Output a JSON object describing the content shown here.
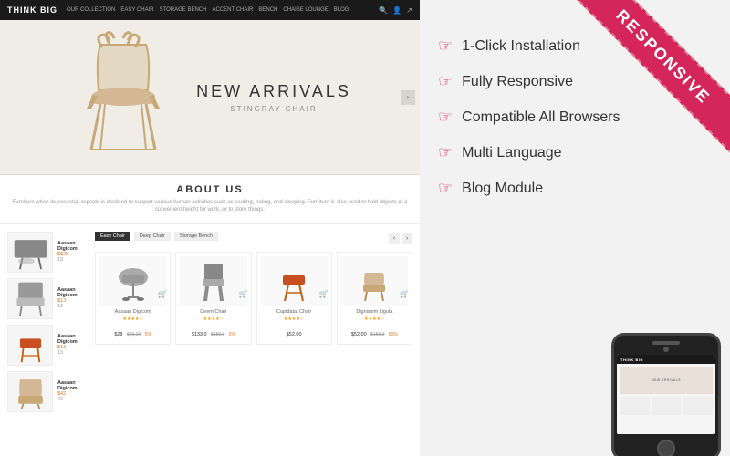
{
  "site": {
    "logo": "THINK BIG",
    "nav_links": [
      "OUR COLLECTION",
      "EASY CHAIR",
      "STORAGE BENCH",
      "ACCENT CHAIR",
      "BENCH",
      "CHAISE LOUNGE",
      "BLOG"
    ],
    "hero": {
      "title": "NEW ARRIVALS",
      "subtitle": "STINGRAY CHAIR"
    },
    "about": {
      "title": "ABOUT US",
      "text": "Furniture when its essential aspects is destined to support various human activities such as seating, eating, and sleeping. Furniture is also used to hold objects of a convenient height\nfor work, or to store things."
    },
    "product_tabs": [
      "Easy Chair",
      "Deep Chair",
      "Storage Bench"
    ],
    "products": [
      {
        "name": "Aasaan Digicom",
        "price": "$28",
        "old_price": "$29.00",
        "discount": "5%",
        "stars": "★★★★",
        "has_new": false
      },
      {
        "name": "Deem Chair",
        "price": "$133.0",
        "old_price": "$159.0",
        "discount": "5%",
        "stars": "★★★★",
        "has_new": false
      },
      {
        "name": "Cupidatat Chair",
        "price": "$52.00",
        "old_price": "",
        "discount": "",
        "stars": "★★★★",
        "has_new": false
      },
      {
        "name": "Dignissim Ligula",
        "price": "$52.00",
        "old_price": "$155.0",
        "discount": "80%",
        "stars": "★★★★",
        "has_new": false
      }
    ],
    "sidebar_products": [
      {
        "name": "Aasaan Digicom",
        "number": "$28",
        "price": "13"
      },
      {
        "name": "Aasaan Digicom",
        "number": "",
        "price": "13"
      },
      {
        "name": "Aasaan Digicom",
        "number": "",
        "price": "13"
      },
      {
        "name": "Aasaan Digicom",
        "number": "",
        "price": "42"
      }
    ]
  },
  "features": {
    "ribbon_text": "RESPONSIVE",
    "items": [
      {
        "icon": "☞",
        "label": "1-Click Installation"
      },
      {
        "icon": "☞",
        "label": "Fully Responsive"
      },
      {
        "icon": "☞",
        "label": "Compatible All Browsers"
      },
      {
        "icon": "☞",
        "label": "Multi Language"
      },
      {
        "icon": "☞",
        "label": "Blog Module"
      }
    ]
  },
  "phone": {
    "logo": "THINK BIG"
  }
}
